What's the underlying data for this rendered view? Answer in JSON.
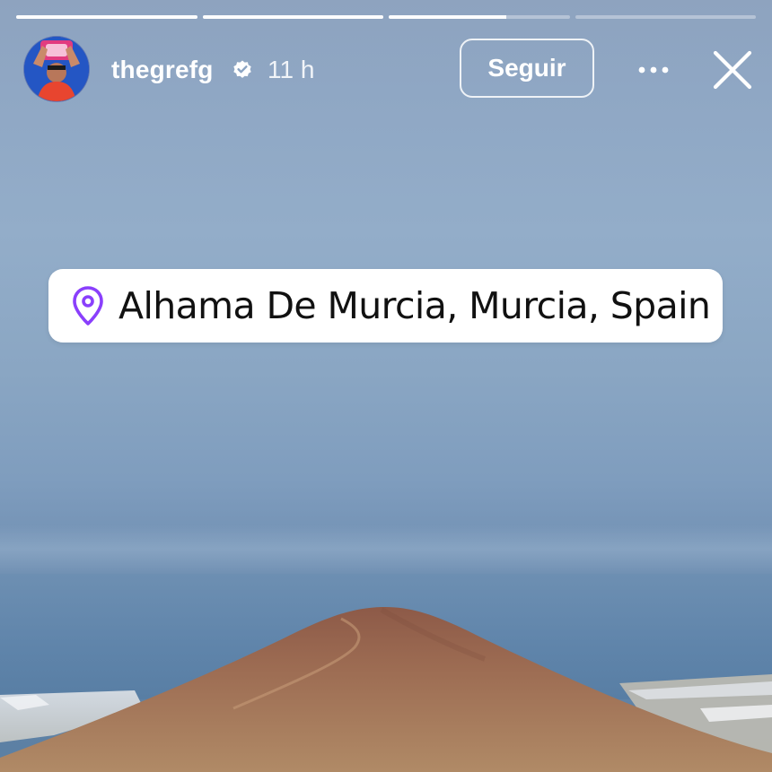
{
  "story": {
    "progress": [
      1,
      1,
      0.65,
      0
    ],
    "user": {
      "username": "thegrefg",
      "verified": true,
      "time_ago": "11 h",
      "avatar_icon": "profile-avatar"
    },
    "actions": {
      "follow_label": "Seguir",
      "more_icon": "more-horizontal-icon",
      "close_icon": "close-icon"
    },
    "location_sticker": {
      "icon": "location-pin-icon",
      "text": "Alhama De Murcia, Murcia, Spain",
      "icon_color": "#8a3ffc"
    }
  }
}
